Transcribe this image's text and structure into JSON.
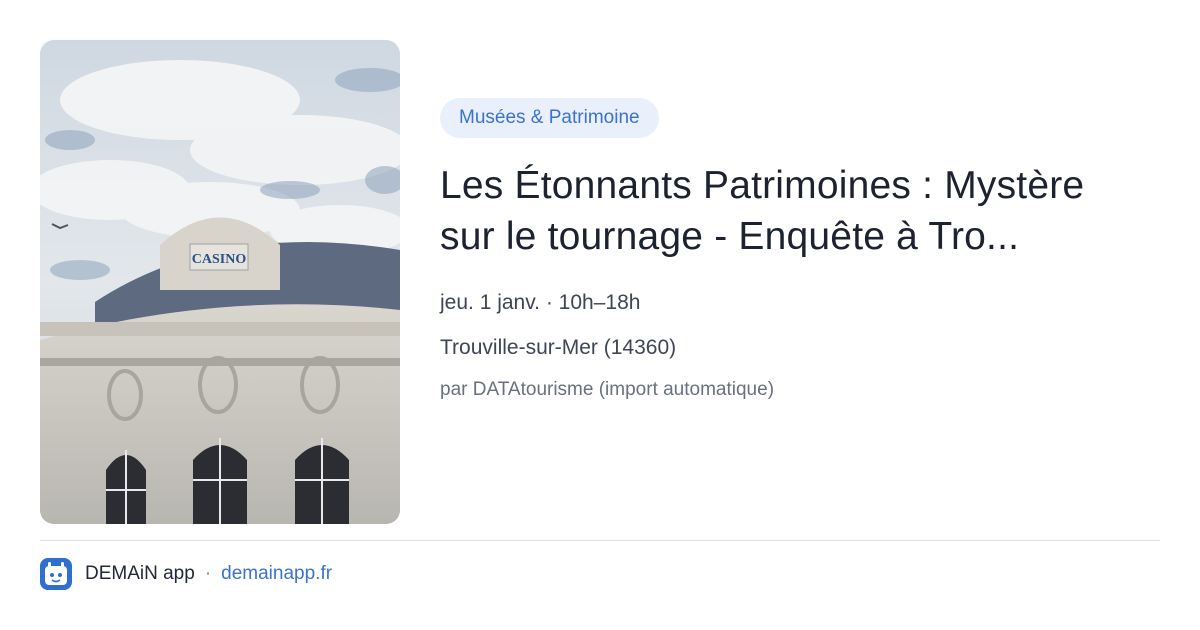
{
  "card": {
    "category": "Musées & Patrimoine",
    "title": "Les Étonnants Patrimoines : Mystère sur le tournage - Enquête à Tro...",
    "datetime": "jeu. 1 janv. · 10h–18h",
    "location": "Trouville-sur-Mer (14360)",
    "source": "par DATAtourisme (import automatique)",
    "image_sign_text": "CASINO"
  },
  "footer": {
    "app_name": "DEMAiN app",
    "separator": "·",
    "domain": "demainapp.fr"
  },
  "colors": {
    "accent": "#3b73c9",
    "badge_bg": "#e9f0fb",
    "logo_bg": "#2f6fd0"
  }
}
